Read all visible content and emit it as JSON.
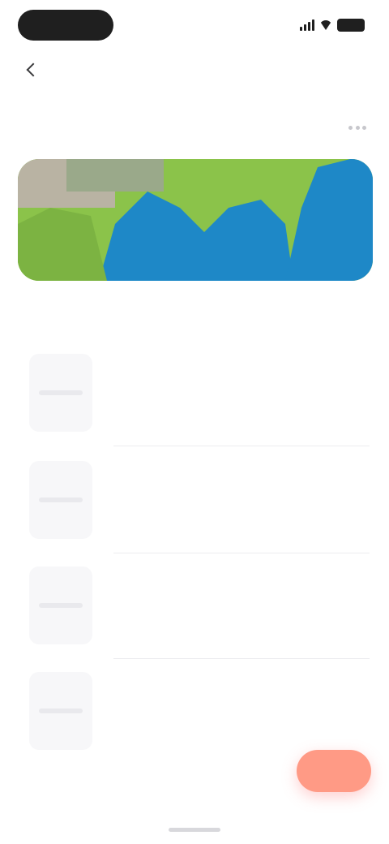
{
  "status_bar": {
    "time": "",
    "battery": ""
  },
  "nav": {
    "title": ""
  },
  "section": {
    "title": ""
  },
  "map": {
    "caption": ""
  },
  "list": {
    "items": [
      {
        "title": "",
        "subtitle": ""
      },
      {
        "title": "",
        "subtitle": ""
      },
      {
        "title": "",
        "subtitle": ""
      },
      {
        "title": "",
        "subtitle": ""
      }
    ]
  },
  "fab": {
    "label": ""
  },
  "colors": {
    "map_green": "#8bc34a",
    "map_blue": "#1e88c7",
    "accent_coral": "#ff9a85"
  },
  "icons": {
    "back": "chevron-left-icon",
    "more": "more-horizontal-icon",
    "signal": "signal-icon",
    "wifi": "wifi-icon",
    "battery": "battery-icon"
  }
}
